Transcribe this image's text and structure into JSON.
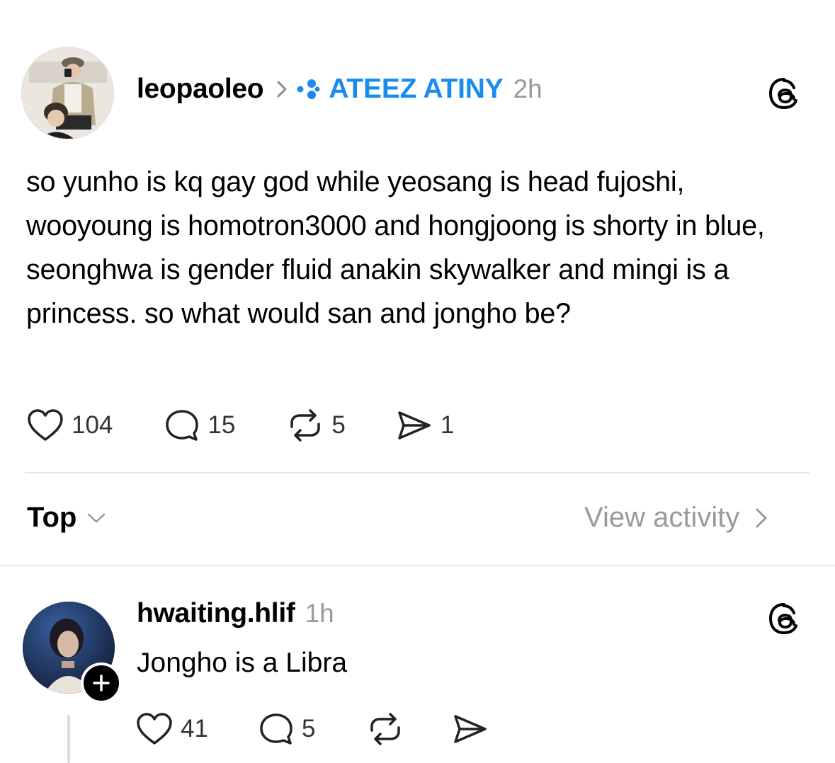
{
  "post": {
    "username": "leopaoleo",
    "separator": "›",
    "community": "ATEEZ ATINY",
    "time": "2h",
    "text": "so yunho is kq gay god while yeosang is head fujoshi, wooyoung is homotron3000 and hongjoong is shorty in blue, seonghwa is gender fluid anakin skywalker and mingi is a princess. so what would san and jongho be?",
    "likes": "104",
    "replies": "15",
    "reposts": "5",
    "shares": "1"
  },
  "sort_bar": {
    "sort_label": "Top",
    "view_activity_label": "View activity",
    "chevron": "›"
  },
  "reply": {
    "username": "hwaiting.hlif",
    "time": "1h",
    "text": "Jongho is a Libra",
    "likes": "41",
    "replies": "5"
  },
  "colors": {
    "community_blue": "#1a8cf0",
    "muted_gray": "#9a9a9a",
    "divider": "#e6e6e6"
  },
  "icons": [
    "threads-logo-icon",
    "heart-icon",
    "comment-icon",
    "repost-icon",
    "send-icon",
    "chevron-right-icon",
    "chevron-down-icon",
    "community-dots-icon",
    "plus-icon"
  ]
}
